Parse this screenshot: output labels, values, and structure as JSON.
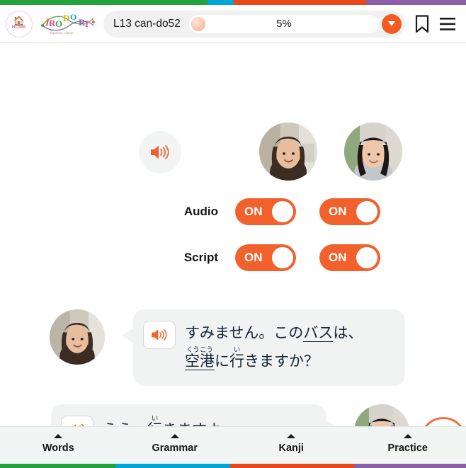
{
  "theme": {
    "accent_orange": "#f2602c",
    "strip_green": "#22a33c",
    "strip_cyan": "#00a6d6",
    "strip_orange": "#e8481a",
    "strip_purple": "#8b5fa8",
    "bubble_gray": "#f1f2f2",
    "nav_bg": "#f1f5f4"
  },
  "header": {
    "home_label": "HOME",
    "home_icon": "home-icon",
    "logo_text": "IRODORI",
    "logo_letters": [
      "I",
      "RO",
      "DO",
      "RI"
    ],
    "logo_subtitle": "Japanese course",
    "lesson_label": "L13 can-do52",
    "progress_percent": "5%",
    "progress_value": 5,
    "caret_icon": "chevron-down-icon",
    "bookmark_icon": "bookmark-icon",
    "menu_icon": "hamburger-menu-icon"
  },
  "settings": {
    "play_all_icon": "speaker-icon",
    "speakers": [
      {
        "name": "speaker-a-avatar"
      },
      {
        "name": "speaker-b-avatar"
      }
    ],
    "rows": [
      {
        "label": "Audio",
        "toggles": [
          {
            "state": "ON"
          },
          {
            "state": "ON"
          }
        ]
      },
      {
        "label": "Script",
        "toggles": [
          {
            "state": "ON"
          },
          {
            "state": "ON"
          }
        ]
      }
    ]
  },
  "dialogue": {
    "lines": [
      {
        "side": "left",
        "play_icon": "speaker-icon",
        "avatar": "speaker-a-avatar",
        "segments": [
          {
            "text": "すみません。このバスは、",
            "plain_prefix": "すみません。この",
            "ruby_base": "バス",
            "ruby_text": "",
            "underline": true,
            "plain_suffix": "は、"
          }
        ],
        "line1": {
          "prefix": "すみません。この",
          "underlined": "バス",
          "suffix": "は、"
        },
        "line2": {
          "kanji1": "空港",
          "furigana1": "くうこう",
          "mid": "に",
          "kanji2": "行",
          "furigana2": "い",
          "suffix": "きますか？"
        }
      },
      {
        "side": "right",
        "play_icon": "speaker-icon",
        "avatar": "speaker-b-avatar",
        "line1": {
          "prefix": "ええ、",
          "kanji": "行",
          "furigana": "い",
          "suffix": "きますよ。"
        }
      }
    ]
  },
  "next_button": {
    "icon": "arrow-right-icon",
    "label": ""
  },
  "bottom_nav": {
    "items": [
      {
        "label": "Words",
        "color": "#22a33c",
        "caret": "chevron-up-icon"
      },
      {
        "label": "Grammar",
        "color": "#00a6d6",
        "caret": "chevron-up-icon"
      },
      {
        "label": "Kanji",
        "color": "#e8481a",
        "caret": "chevron-up-icon"
      },
      {
        "label": "Practice",
        "color": "#8b5fa8",
        "caret": "chevron-up-icon"
      }
    ]
  }
}
